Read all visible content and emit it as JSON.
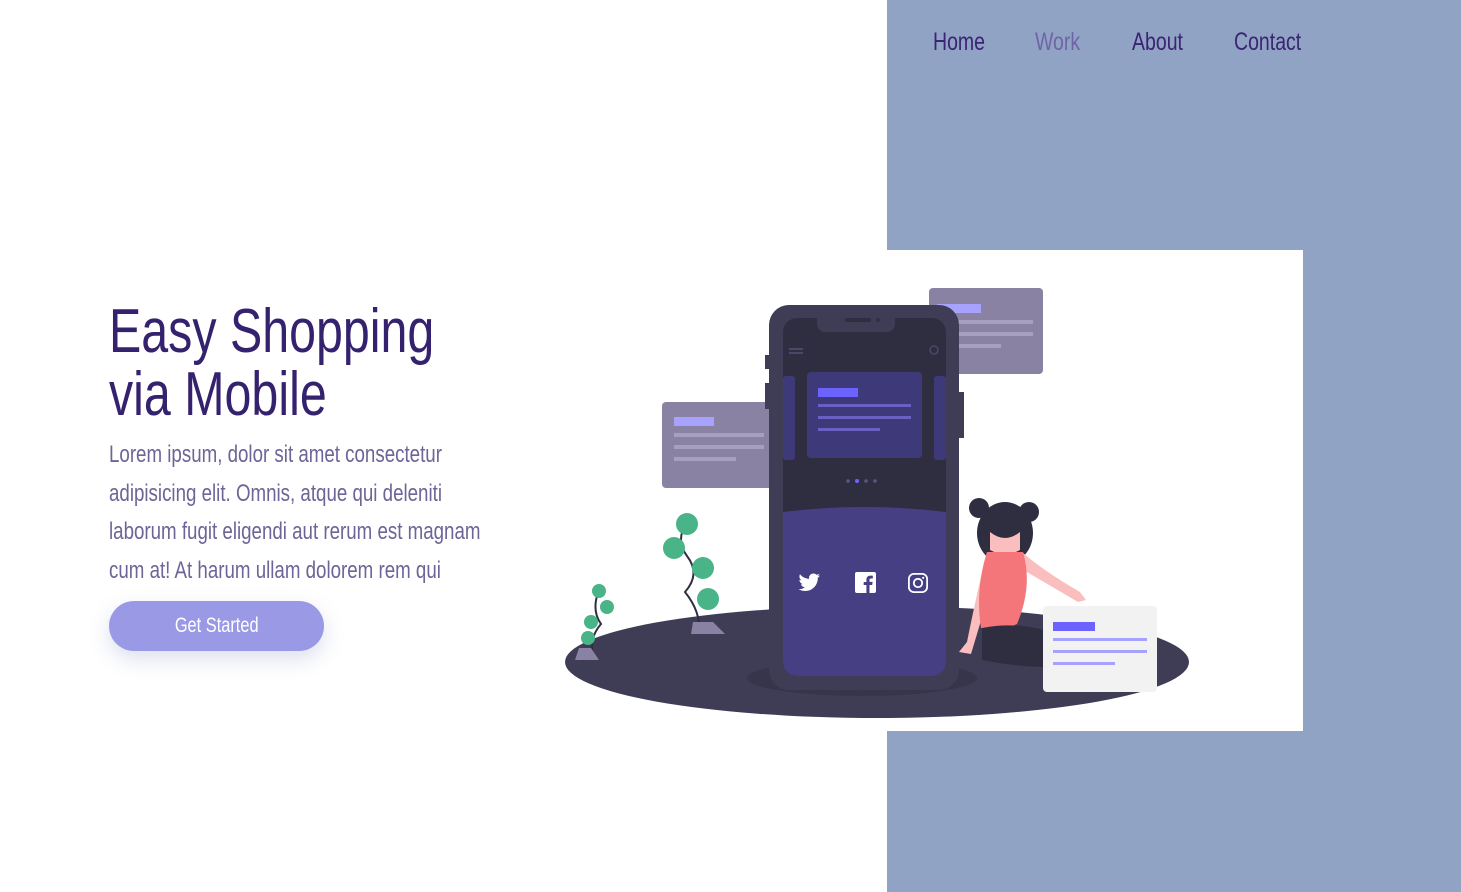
{
  "nav": {
    "items": [
      {
        "label": "Home"
      },
      {
        "label": "Work"
      },
      {
        "label": "About"
      },
      {
        "label": "Contact"
      }
    ]
  },
  "hero": {
    "title_line1": "Easy Shopping",
    "title_line2": "via Mobile",
    "description": "Lorem ipsum, dolor sit amet consectetur adipisicing elit. Omnis, atque qui deleniti laborum fugit eligendi aut rerum est magnam cum at! At harum ullam dolorem rem qui perferendis illo?",
    "cta_label": "Get Started"
  },
  "colors": {
    "panel": "#91a3c4",
    "heading": "#35226f",
    "body_text": "#6d6597",
    "button": "#9a99e6",
    "phone": "#3f3d56",
    "accent": "#6c63ff"
  },
  "illustration": {
    "icons": [
      "twitter-icon",
      "facebook-icon",
      "instagram-icon"
    ]
  }
}
